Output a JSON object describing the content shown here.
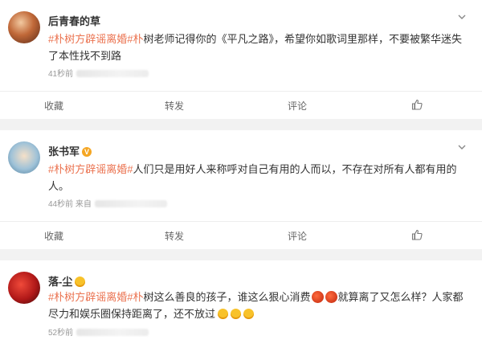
{
  "posts": [
    {
      "username": "后青春的草",
      "hashtag1": "#朴树方辟谣离婚#",
      "mention": "朴",
      "text": "树老师记得你的《平凡之路》，希望你如歌词里那样，不要被繁华迷失了本性找不到路",
      "time": "41秒前",
      "actions": {
        "fav": "收藏",
        "repost": "转发",
        "comment": "评论"
      }
    },
    {
      "username": "张书军",
      "hashtag1": "#朴树方辟谣离婚#",
      "text": "人们只是用好人来称呼对自己有用的人而以，不存在对所有人都有用的人。",
      "time": "44秒前",
      "source_prefix": "来自",
      "actions": {
        "fav": "收藏",
        "repost": "转发",
        "comment": "评论"
      }
    },
    {
      "username": "落-尘",
      "hashtag1": "#朴树方辟谣离婚#",
      "mention": "朴",
      "text_a": "树这么善良的孩子，谁这么狠心消费",
      "text_b": "就算离了又怎么样？人家都尽力和娱乐圈保持距离了，还不放过",
      "time": "52秒前"
    }
  ]
}
